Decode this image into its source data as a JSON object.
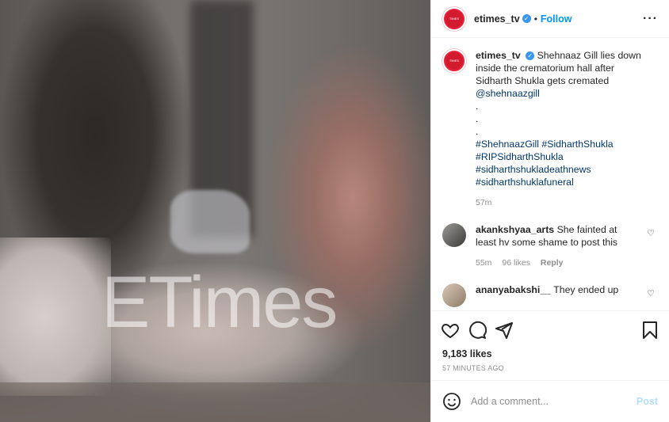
{
  "account": {
    "username": "etimes_tv",
    "follow_label": "Follow",
    "avatar_text": "TIMES"
  },
  "photo": {
    "watermark": "ETimes"
  },
  "caption": {
    "username": "etimes_tv",
    "text": "Shehnaaz Gill lies down inside the crematorium hall after Sidharth Shukla gets cremated",
    "mention": "@shehnaazgill",
    "dots": [
      ".",
      ".",
      "."
    ],
    "hashtags": [
      "#ShehnaazGill",
      "#SidharthShukla",
      "#RIPSidharthShukla",
      "#sidharthshukladeathnews",
      "#sidharthshuklafuneral"
    ],
    "time": "57m"
  },
  "comments": [
    {
      "username": "akankshyaa_arts",
      "text": "She fainted at least hv some shame to post this",
      "time": "55m",
      "likes": "96 likes",
      "reply": "Reply"
    },
    {
      "username": "ananyabakshi__",
      "text": "They ended up",
      "time": "",
      "likes": "",
      "reply": ""
    }
  ],
  "stats": {
    "likes": "9,183 likes",
    "posted": "57 MINUTES AGO"
  },
  "composer": {
    "placeholder": "Add a comment...",
    "post_label": "Post"
  },
  "icons": {
    "like": "heart-icon",
    "comment": "comment-icon",
    "share": "share-icon",
    "save": "bookmark-icon",
    "more": "more-icon",
    "emoji": "emoji-icon"
  },
  "colors": {
    "link": "#0095f6",
    "verified": "#3897f0",
    "brand": "#e8203a"
  }
}
